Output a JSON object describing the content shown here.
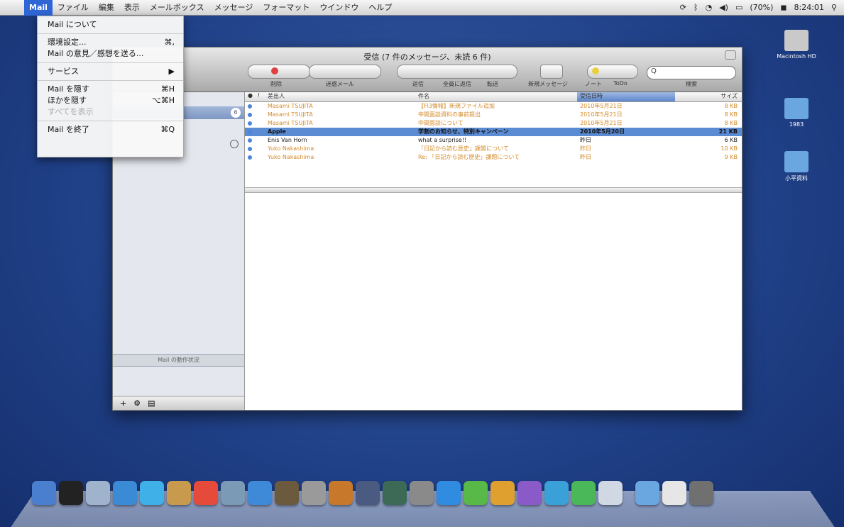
{
  "menubar": {
    "apple_icon": "apple-icon",
    "items": [
      "Mail",
      "ファイル",
      "編集",
      "表示",
      "メールボックス",
      "メッセージ",
      "フォーマット",
      "ウインドウ",
      "ヘルプ"
    ],
    "active_item": "Mail",
    "status": {
      "clock": "8:24:01",
      "battery": "(70%)",
      "icons": [
        "sync-icon",
        "bluetooth-icon",
        "wifi-icon",
        "volume-icon",
        "battery-icon",
        "user-icon",
        "spotlight-icon"
      ]
    }
  },
  "mail_menu": {
    "items": [
      {
        "label": "Mail について",
        "shortcut": ""
      },
      {
        "sep": true
      },
      {
        "label": "環境設定...",
        "shortcut": "⌘,"
      },
      {
        "label": "Mail の意見／感想を送る...",
        "shortcut": ""
      },
      {
        "sep": true
      },
      {
        "label": "サービス",
        "shortcut": "▶"
      },
      {
        "sep": true
      },
      {
        "label": "Mail を隠す",
        "shortcut": "⌘H"
      },
      {
        "label": "ほかを隠す",
        "shortcut": "⌥⌘H"
      },
      {
        "label": "すべてを表示",
        "shortcut": "",
        "disabled": true
      },
      {
        "sep": true
      },
      {
        "label": "Mail を終了",
        "shortcut": "⌘Q"
      }
    ]
  },
  "window": {
    "title": "受信 (7 件のメッセージ、未読 6 件)",
    "toolbar": {
      "labels": [
        "削除",
        "迷惑メール",
        "返信",
        "全員に返信",
        "転送",
        "新規メッセージ",
        "ノート",
        "ToDo",
        "検索"
      ],
      "search_placeholder": "Q"
    },
    "sidebar": {
      "badge": "6",
      "divider_label": "Mail の動作状況",
      "footer_icons": [
        "add-icon",
        "gear-icon",
        "tasks-icon"
      ]
    },
    "list": {
      "headers": [
        "●",
        "!",
        "差出人",
        "件名",
        "受信日時",
        "サイズ"
      ],
      "rows": [
        {
          "from": "Masami TSUJITA",
          "subject": "【Fl3情報】新規ファイル追加",
          "date": "2010年5月21日",
          "size": "8 KB",
          "state": "read"
        },
        {
          "from": "Masami TSUJITA",
          "subject": "中間面談資料の事前提出",
          "date": "2010年5月21日",
          "size": "8 KB",
          "state": "read"
        },
        {
          "from": "Masami TSUJITA",
          "subject": "中間面談について",
          "date": "2010年5月21日",
          "size": "8 KB",
          "state": "read"
        },
        {
          "from": "Apple",
          "subject": "学割のお知らせ、特別キャンペーン",
          "date": "2010年5月20日",
          "size": "21 KB",
          "state": "selected"
        },
        {
          "from": "Enis Van Horn",
          "subject": "what a surprise!!",
          "date": "昨日",
          "size": "6 KB",
          "state": "plain"
        },
        {
          "from": "Yuko Nakashima",
          "subject": "「日記から読む歴史」課題について",
          "date": "昨日",
          "size": "10 KB",
          "state": "read"
        },
        {
          "from": "Yuko Nakashima",
          "subject": "Re: 「日記から読む歴史」課題について",
          "date": "昨日",
          "size": "9 KB",
          "state": "read"
        }
      ]
    }
  },
  "desktop": {
    "icons": [
      {
        "label": "Macintosh HD",
        "color": "#c9c9c9"
      },
      {
        "label": "1983",
        "color": "#6aa6df"
      },
      {
        "label": "小平資料",
        "color": "#6aa6df"
      }
    ]
  },
  "dock": {
    "items": [
      {
        "name": "finder-icon",
        "color": "#4a7fd0"
      },
      {
        "name": "dashboard-icon",
        "color": "#222222"
      },
      {
        "name": "mail-icon",
        "color": "#9fb4cc"
      },
      {
        "name": "safari-icon",
        "color": "#3a8ad6"
      },
      {
        "name": "ichat-icon",
        "color": "#3fb0e8"
      },
      {
        "name": "address-book-icon",
        "color": "#c89a4e"
      },
      {
        "name": "ical-icon",
        "color": "#e64a3a"
      },
      {
        "name": "preview-icon",
        "color": "#7a9ab6"
      },
      {
        "name": "itunes-icon",
        "color": "#3f8ad8"
      },
      {
        "name": "iphoto-icon",
        "color": "#6b5a3e"
      },
      {
        "name": "imovie-icon",
        "color": "#9a9a9a"
      },
      {
        "name": "garageband-icon",
        "color": "#c8782a"
      },
      {
        "name": "spaces-icon",
        "color": "#4a5a80"
      },
      {
        "name": "time-machine-icon",
        "color": "#3c6a56"
      },
      {
        "name": "system-preferences-icon",
        "color": "#8a8a8a"
      },
      {
        "name": "app-icon-1",
        "color": "#2f8ce0"
      },
      {
        "name": "app-icon-2",
        "color": "#58b848"
      },
      {
        "name": "app-icon-3",
        "color": "#e0a030"
      },
      {
        "name": "app-icon-4",
        "color": "#8a5ac8"
      },
      {
        "name": "app-icon-5",
        "color": "#3aa0d8"
      },
      {
        "name": "app-icon-6",
        "color": "#4ab858"
      },
      {
        "name": "app-icon-7",
        "color": "#d0d8e4"
      },
      {
        "name": "applications-folder-icon",
        "color": "#6aa6df"
      },
      {
        "name": "documents-icon",
        "color": "#e6e6e6"
      },
      {
        "name": "trash-icon",
        "color": "#707070"
      }
    ]
  }
}
